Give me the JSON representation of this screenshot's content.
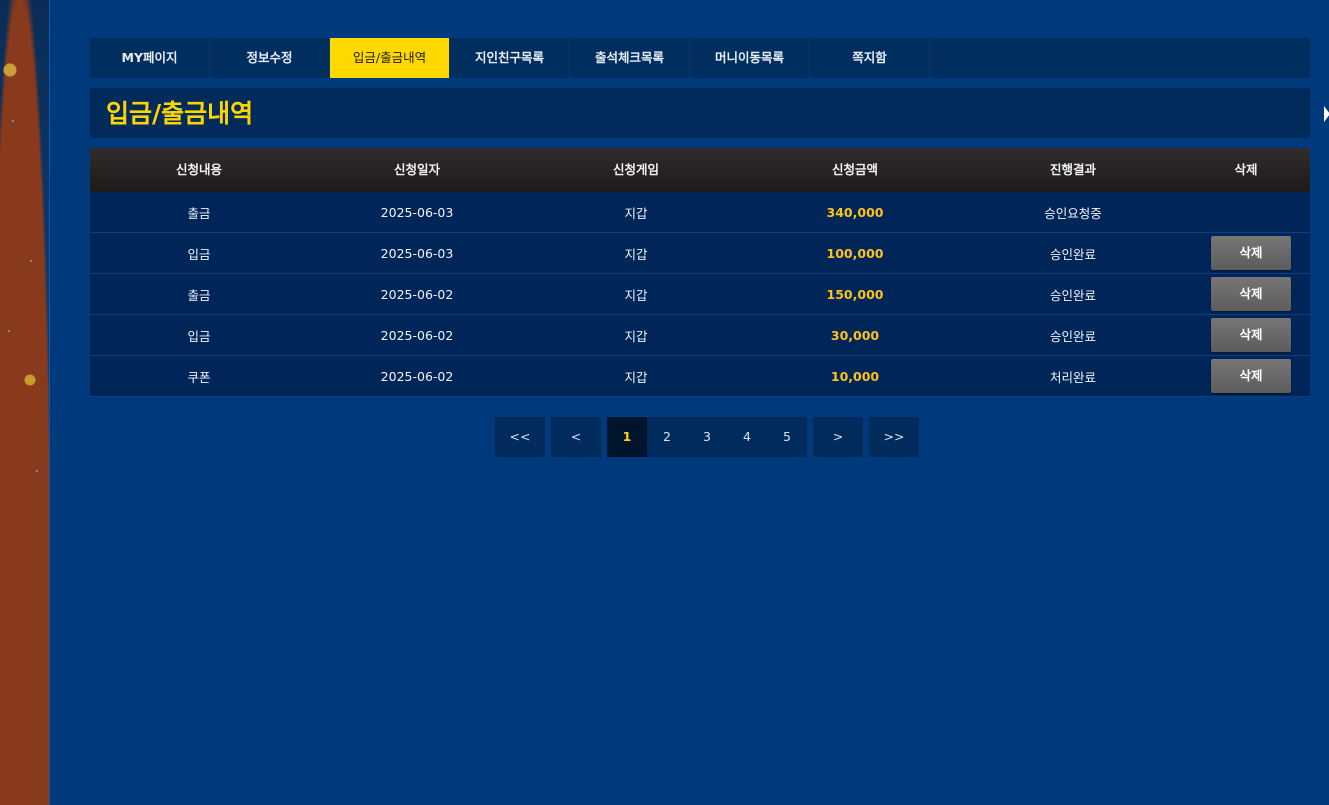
{
  "tabs": [
    {
      "label": "MY페이지"
    },
    {
      "label": "정보수정"
    },
    {
      "label": "입금/출금내역",
      "active": true
    },
    {
      "label": "지인친구목록"
    },
    {
      "label": "출석체크목록"
    },
    {
      "label": "머니이동목록"
    },
    {
      "label": "쪽지함"
    }
  ],
  "page_title": "입금/출금내역",
  "table": {
    "headers": [
      "신청내용",
      "신청일자",
      "신청게임",
      "신청금액",
      "진행결과",
      "삭제"
    ],
    "rows": [
      {
        "type": "출금",
        "date": "2025-06-03",
        "game": "지갑",
        "amount": "340,000",
        "status": "승인요청중",
        "delete": ""
      },
      {
        "type": "입금",
        "date": "2025-06-03",
        "game": "지갑",
        "amount": "100,000",
        "status": "승인완료",
        "delete": "삭제"
      },
      {
        "type": "출금",
        "date": "2025-06-02",
        "game": "지갑",
        "amount": "150,000",
        "status": "승인완료",
        "delete": "삭제"
      },
      {
        "type": "입금",
        "date": "2025-06-02",
        "game": "지갑",
        "amount": "30,000",
        "status": "승인완료",
        "delete": "삭제"
      },
      {
        "type": "쿠폰",
        "date": "2025-06-02",
        "game": "지갑",
        "amount": "10,000",
        "status": "처리완료",
        "delete": "삭제"
      }
    ]
  },
  "pagination": {
    "first": "<<",
    "prev": "<",
    "pages": [
      "1",
      "2",
      "3",
      "4",
      "5"
    ],
    "current": "1",
    "next": ">",
    "last": ">>"
  },
  "colors": {
    "accent": "#ffd400",
    "amount": "#ffc21a",
    "panel": "#003a7c"
  }
}
